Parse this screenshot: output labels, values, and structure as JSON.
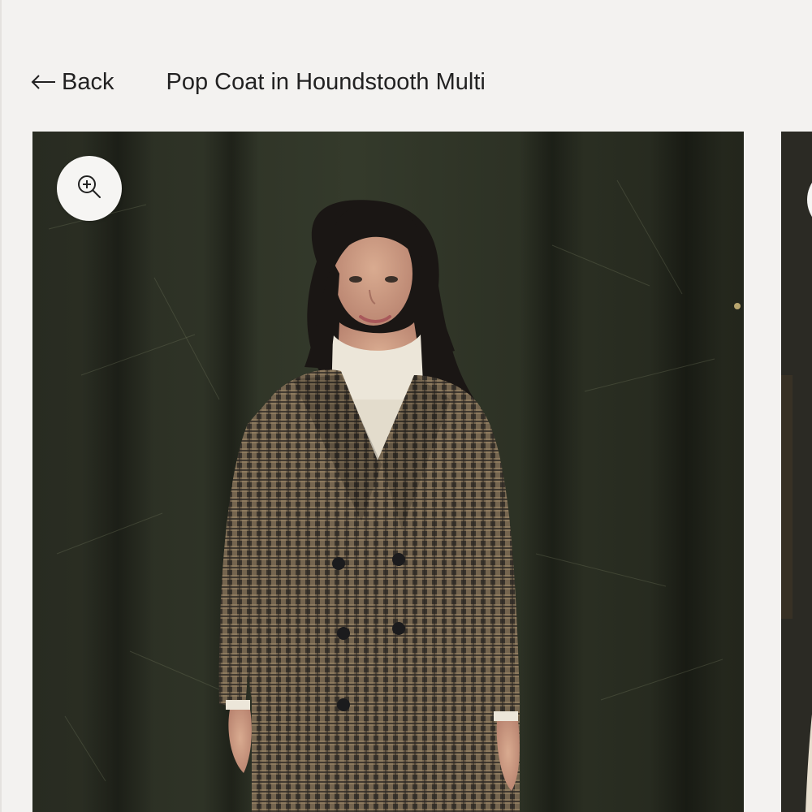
{
  "header": {
    "back_label": "Back",
    "back_icon": "arrow-left-icon",
    "product_title": "Pop Coat in Houndstooth Multi"
  },
  "gallery": {
    "zoom_icon": "zoom-in-icon",
    "images": [
      {
        "alt": "Model wearing the Pop Coat in Houndstooth Multi over a cream turtleneck"
      },
      {
        "alt": "Next product image"
      }
    ]
  },
  "colors": {
    "background": "#f3f2f0",
    "backdrop": "#2e3224",
    "coat": "#6b5d4c",
    "turtleneck": "#ebe5d8",
    "text": "#222222"
  }
}
